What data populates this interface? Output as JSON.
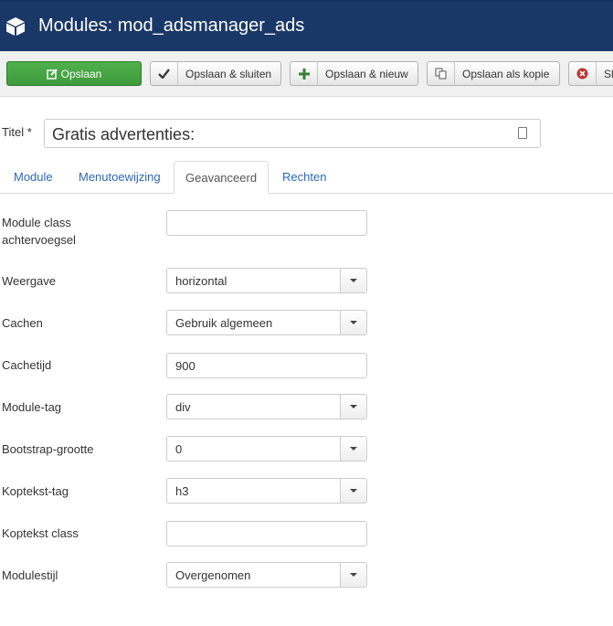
{
  "header": {
    "title": "Modules: mod_adsmanager_ads",
    "icon": "cube-icon"
  },
  "toolbar": {
    "save": "Opslaan",
    "save_close": "Opslaan & sluiten",
    "save_new": "Opslaan & nieuw",
    "save_copy": "Opslaan als kopie",
    "close_partial": "Sl"
  },
  "title_field": {
    "label": "Titel *",
    "value": "Gratis advertenties:"
  },
  "tabs": [
    "Module",
    "Menutoewijzing",
    "Geavanceerd",
    "Rechten"
  ],
  "active_tab": "Geavanceerd",
  "fields": [
    {
      "label_line1": "Module class",
      "label_line2": "achtervoegsel",
      "type": "text",
      "value": ""
    },
    {
      "label": "Weergave",
      "type": "select",
      "value": "horizontal"
    },
    {
      "label": "Cachen",
      "type": "select",
      "value": "Gebruik algemeen"
    },
    {
      "label": "Cachetijd",
      "type": "text",
      "value": "900"
    },
    {
      "label": "Module-tag",
      "type": "select",
      "value": "div"
    },
    {
      "label": "Bootstrap-grootte",
      "type": "select",
      "value": "0"
    },
    {
      "label": "Koptekst-tag",
      "type": "select",
      "value": "h3"
    },
    {
      "label": "Koptekst class",
      "type": "text",
      "value": ""
    },
    {
      "label": "Modulestijl",
      "type": "select",
      "value": "Overgenomen"
    }
  ],
  "colors": {
    "header_bg": "#1a3867",
    "save_green": "#46a546",
    "link_blue": "#2a69b8"
  }
}
